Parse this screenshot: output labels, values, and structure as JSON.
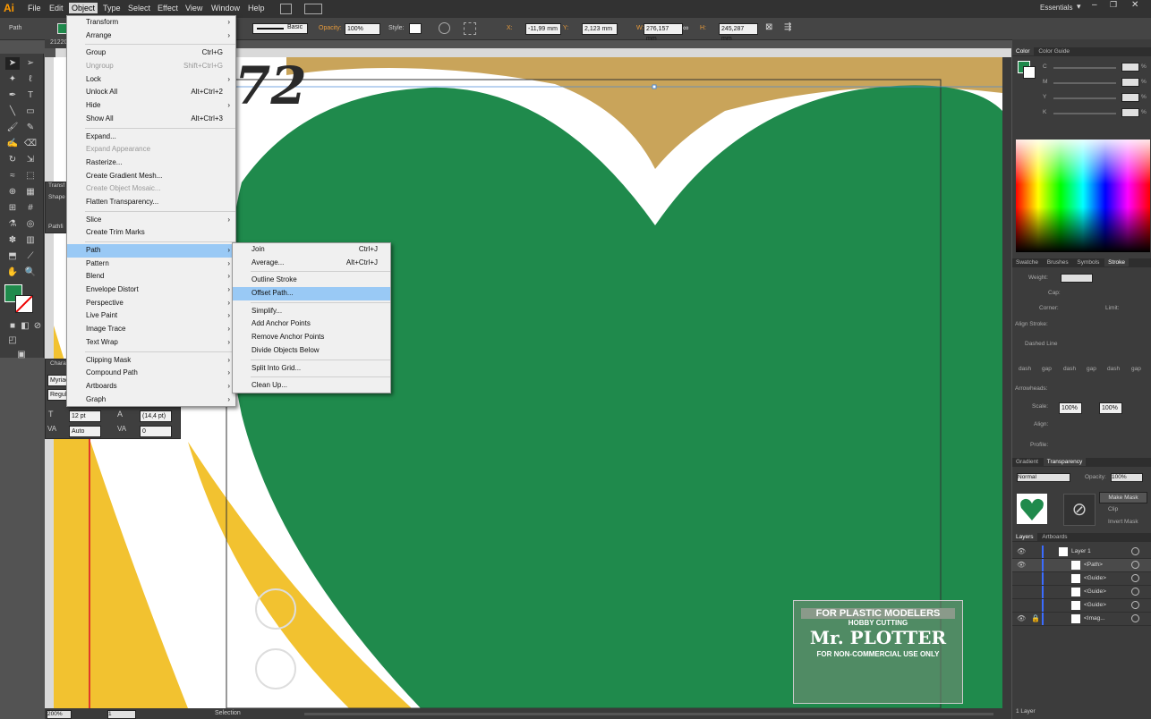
{
  "app": {
    "logo": "Ai",
    "workspace": "Essentials"
  },
  "menubar": {
    "items": [
      "File",
      "Edit",
      "Object",
      "Type",
      "Select",
      "Effect",
      "View",
      "Window",
      "Help"
    ],
    "active": "Object"
  },
  "controlbar": {
    "selection_label": "Path",
    "stroke_style": "Basic",
    "opacity_label": "Opacity:",
    "opacity_value": "100%",
    "style_label": "Style:",
    "x_label": "X:",
    "x_value": "-11,99 mm",
    "y_label": "Y:",
    "y_value": "2,123 mm",
    "w_label": "W:",
    "w_value": "276,157 mm",
    "h_label": "H:",
    "h_value": "245,287 mm"
  },
  "document": {
    "tab_label": "21220",
    "zoom": "200%",
    "artboard_num": "1",
    "status_text": "Selection",
    "layer_count": "1 Layer",
    "artwork_number": "72"
  },
  "object_menu": {
    "items": [
      {
        "label": "Transform",
        "submenu": true
      },
      {
        "label": "Arrange",
        "submenu": true
      },
      {
        "sep": true
      },
      {
        "label": "Group",
        "shortcut": "Ctrl+G"
      },
      {
        "label": "Ungroup",
        "shortcut": "Shift+Ctrl+G",
        "disabled": true
      },
      {
        "label": "Lock",
        "submenu": true
      },
      {
        "label": "Unlock All",
        "shortcut": "Alt+Ctrl+2"
      },
      {
        "label": "Hide",
        "submenu": true
      },
      {
        "label": "Show All",
        "shortcut": "Alt+Ctrl+3"
      },
      {
        "sep": true
      },
      {
        "label": "Expand..."
      },
      {
        "label": "Expand Appearance",
        "disabled": true
      },
      {
        "label": "Rasterize..."
      },
      {
        "label": "Create Gradient Mesh..."
      },
      {
        "label": "Create Object Mosaic...",
        "disabled": true
      },
      {
        "label": "Flatten Transparency..."
      },
      {
        "sep": true
      },
      {
        "label": "Slice",
        "submenu": true
      },
      {
        "label": "Create Trim Marks"
      },
      {
        "sep": true
      },
      {
        "label": "Path",
        "submenu": true,
        "highlight": true
      },
      {
        "label": "Pattern",
        "submenu": true
      },
      {
        "label": "Blend",
        "submenu": true
      },
      {
        "label": "Envelope Distort",
        "submenu": true
      },
      {
        "label": "Perspective",
        "submenu": true
      },
      {
        "label": "Live Paint",
        "submenu": true
      },
      {
        "label": "Image Trace",
        "submenu": true
      },
      {
        "label": "Text Wrap",
        "submenu": true
      },
      {
        "sep": true
      },
      {
        "label": "Clipping Mask",
        "submenu": true
      },
      {
        "label": "Compound Path",
        "submenu": true
      },
      {
        "label": "Artboards",
        "submenu": true
      },
      {
        "label": "Graph",
        "submenu": true
      }
    ]
  },
  "path_submenu": {
    "items": [
      {
        "label": "Join",
        "shortcut": "Ctrl+J"
      },
      {
        "label": "Average...",
        "shortcut": "Alt+Ctrl+J"
      },
      {
        "sep": true
      },
      {
        "label": "Outline Stroke"
      },
      {
        "label": "Offset Path...",
        "highlight": true
      },
      {
        "sep": true
      },
      {
        "label": "Simplify..."
      },
      {
        "label": "Add Anchor Points"
      },
      {
        "label": "Remove Anchor Points"
      },
      {
        "label": "Divide Objects Below"
      },
      {
        "sep": true
      },
      {
        "label": "Split Into Grid..."
      },
      {
        "sep": true
      },
      {
        "label": "Clean Up..."
      }
    ]
  },
  "left_panels": {
    "transform_tab": "Transf",
    "shape_tab": "Shape",
    "pathfinder_tab": "Pathfi",
    "character_tab": "Chara",
    "font_family": "Myriad",
    "font_style": "Regula",
    "font_size": "12 pt",
    "leading": "(14,4 pt)",
    "kerning": "Auto",
    "tracking": "0"
  },
  "color_panel": {
    "tabs": [
      "Color",
      "Color Guide"
    ],
    "channels": [
      "C",
      "M",
      "Y",
      "K"
    ],
    "pct": "%"
  },
  "stroke_panel": {
    "tabs": [
      "Swatche",
      "Brushes",
      "Symbols",
      "Stroke"
    ],
    "weight_label": "Weight:",
    "cap_label": "Cap:",
    "corner_label": "Corner:",
    "limit_label": "Limit:",
    "align_stroke_label": "Align Stroke:",
    "dashed_line_label": "Dashed Line",
    "dash_labels": [
      "dash",
      "gap",
      "dash",
      "gap",
      "dash",
      "gap"
    ],
    "arrowheads_label": "Arrowheads:",
    "scale_label": "Scale:",
    "scale_1": "100%",
    "scale_2": "100%",
    "align_label": "Align:",
    "profile_label": "Profile:"
  },
  "transparency_panel": {
    "tabs": [
      "Gradient",
      "Transparency"
    ],
    "blend_mode": "Normal",
    "opacity_label": "Opacity:",
    "opacity_value": "100%",
    "make_mask": "Make Mask",
    "clip": "Clip",
    "invert_mask": "Invert Mask"
  },
  "layers_panel": {
    "tabs": [
      "Layers",
      "Artboards"
    ],
    "rows": [
      {
        "name": "Layer 1",
        "indent": 0,
        "visible": true
      },
      {
        "name": "<Path>",
        "indent": 1,
        "visible": true,
        "selected": true
      },
      {
        "name": "<Guide>",
        "indent": 1,
        "visible": false
      },
      {
        "name": "<Guide>",
        "indent": 1,
        "visible": false
      },
      {
        "name": "<Guide>",
        "indent": 1,
        "visible": false
      },
      {
        "name": "<Imag...",
        "indent": 1,
        "visible": true,
        "locked": true
      }
    ]
  },
  "watermark": {
    "line1": "FOR PLASTIC MODELERS",
    "line2": "HOBBY CUTTING",
    "line3": "Mr. PLOTTER",
    "line4": "FOR NON-COMMERCIAL USE ONLY"
  },
  "colors": {
    "heart_green": "#1f8a4c",
    "gold": "#c9a45a",
    "yellow": "#f2c230",
    "menu_highlight": "#99c9f5"
  }
}
